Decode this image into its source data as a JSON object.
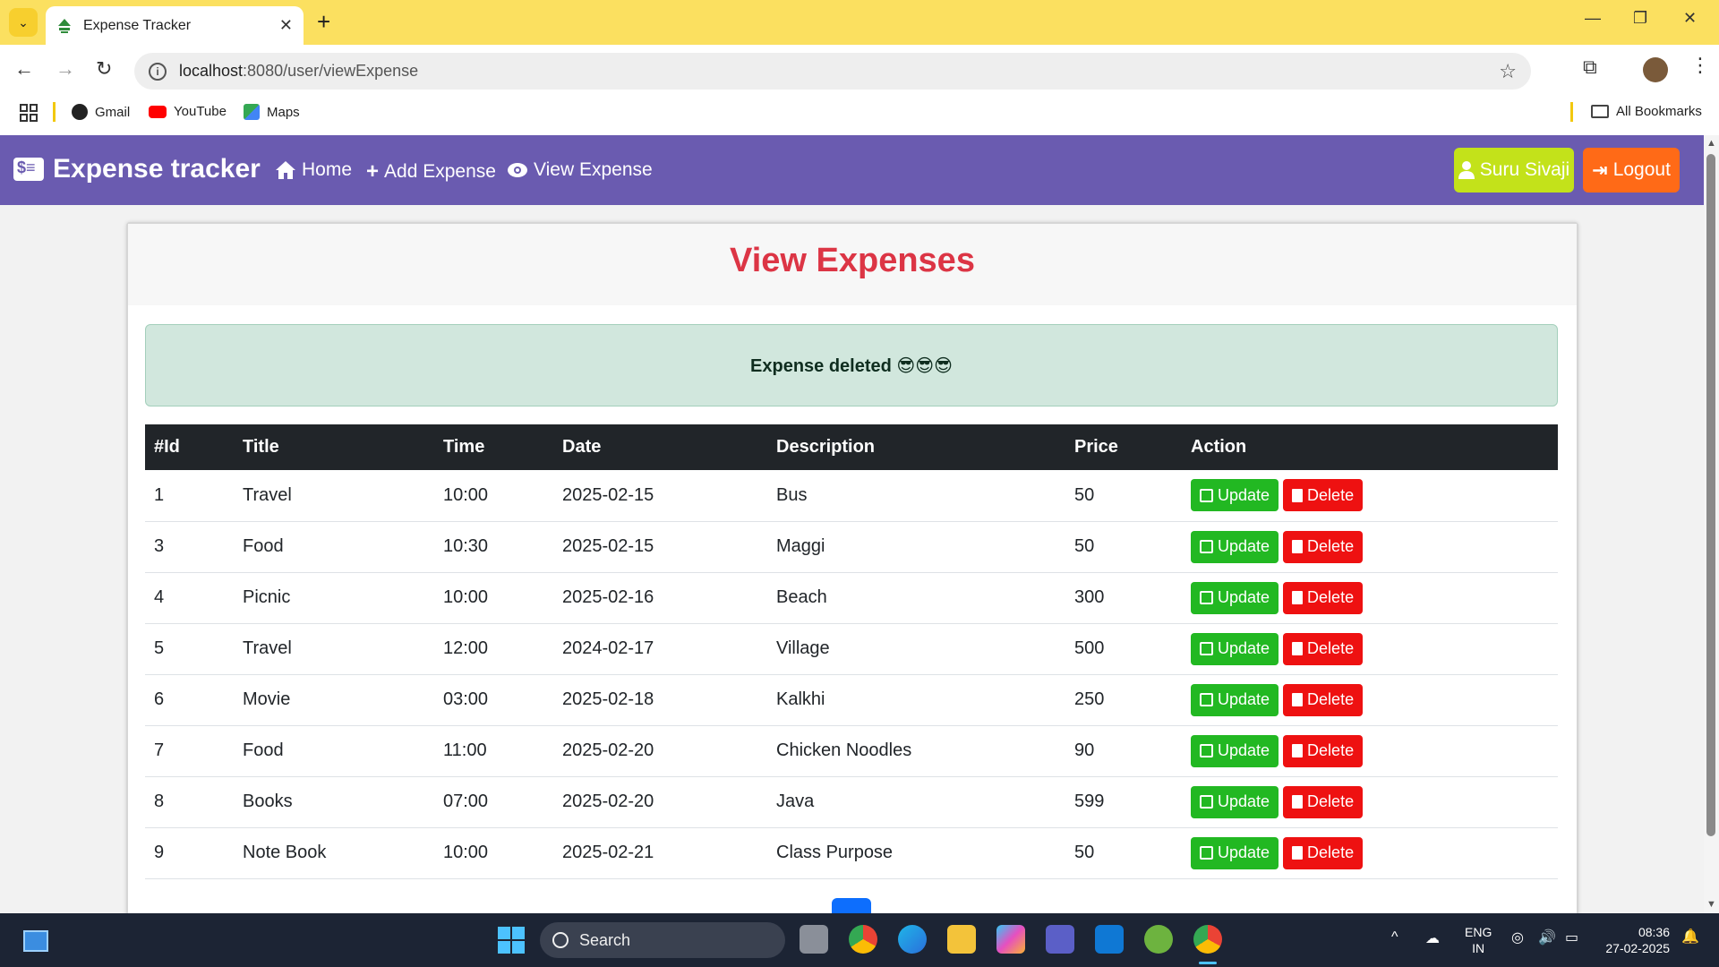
{
  "browser": {
    "tab_title": "Expense Tracker",
    "url_host": "localhost",
    "url_rest": ":8080/user/viewExpense",
    "bookmarks": [
      "Gmail",
      "YouTube",
      "Maps"
    ],
    "all_bookmarks": "All Bookmarks"
  },
  "navbar": {
    "brand": "Expense tracker",
    "links": [
      "Home",
      "Add Expense",
      "View Expense"
    ],
    "user_button": "Suru Sivaji",
    "logout_button": "Logout"
  },
  "main": {
    "title": "View Expenses",
    "alert": "Expense deleted 😎😎😎",
    "columns": [
      "#Id",
      "Title",
      "Time",
      "Date",
      "Description",
      "Price",
      "Action"
    ],
    "rows": [
      [
        "1",
        "Travel",
        "10:00",
        "2025-02-15",
        "Bus",
        "50"
      ],
      [
        "3",
        "Food",
        "10:30",
        "2025-02-15",
        "Maggi",
        "50"
      ],
      [
        "4",
        "Picnic",
        "10:00",
        "2025-02-16",
        "Beach",
        "300"
      ],
      [
        "5",
        "Travel",
        "12:00",
        "2024-02-17",
        "Village",
        "500"
      ],
      [
        "6",
        "Movie",
        "03:00",
        "2025-02-18",
        "Kalkhi",
        "250"
      ],
      [
        "7",
        "Food",
        "11:00",
        "2025-02-20",
        "Chicken Noodles",
        "90"
      ],
      [
        "8",
        "Books",
        "07:00",
        "2025-02-20",
        "Java",
        "599"
      ],
      [
        "9",
        "Note Book",
        "10:00",
        "2025-02-21",
        "Class Purpose",
        "50"
      ]
    ],
    "update_label": "Update",
    "delete_label": "Delete"
  },
  "taskbar": {
    "search_label": "Search",
    "lang_top": "ENG",
    "lang_bottom": "IN",
    "time": "08:36",
    "date": "27-02-2025"
  },
  "colors": {
    "navbar": "#6a5bb0",
    "title": "#dc3545",
    "update": "#22b822",
    "delete": "#ee1111",
    "user": "#c3e21a",
    "logout": "#ff6a17"
  }
}
